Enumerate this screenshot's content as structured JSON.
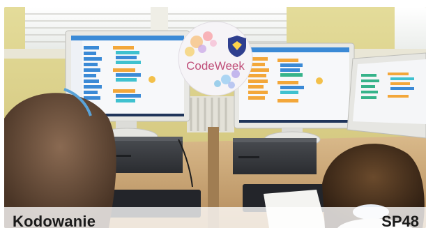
{
  "photo": {
    "badge": {
      "label": "CodeWeek",
      "icon": "shield-icon"
    }
  },
  "caption": {
    "title": "Kodowanie",
    "code": "SP48"
  },
  "colors": {
    "wall": "#d9cf86",
    "desk": "#c9a77a",
    "screen_bezel": "#e6e6e2",
    "editor_blue": "#3b8ad6",
    "block_orange": "#f3a73a",
    "block_green": "#36b38a",
    "block_teal": "#3fc1cf"
  }
}
